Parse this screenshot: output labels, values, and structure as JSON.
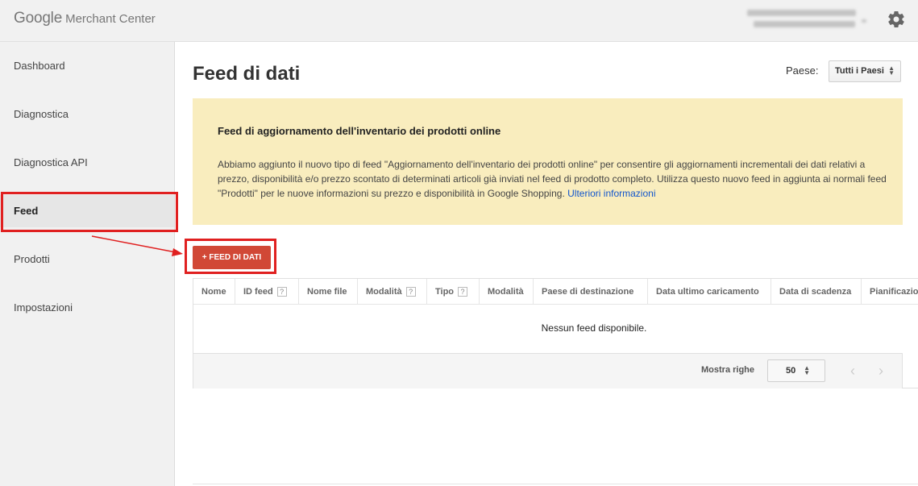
{
  "header": {
    "brand": "Google",
    "product": "Merchant Center"
  },
  "sidebar": {
    "items": [
      {
        "label": "Dashboard"
      },
      {
        "label": "Diagnostica"
      },
      {
        "label": "Diagnostica API"
      },
      {
        "label": "Feed"
      },
      {
        "label": "Prodotti"
      },
      {
        "label": "Impostazioni"
      }
    ],
    "active": "Feed"
  },
  "main": {
    "title": "Feed di dati",
    "country_label": "Paese:",
    "country_value": "Tutti i Paesi",
    "notice": {
      "title": "Feed di aggiornamento dell'inventario dei prodotti online",
      "body": "Abbiamo aggiunto il nuovo tipo di feed \"Aggiornamento dell'inventario dei prodotti online\" per consentire gli aggiornamenti incrementali dei dati relativi a prezzo, disponibilità e/o prezzo scontato di determinati articoli già inviati nel feed di prodotto completo. Utilizza questo nuovo feed in aggiunta ai normali feed \"Prodotti\" per le nuove informazioni su prezzo e disponibilità in Google Shopping.",
      "link": "Ulteriori informazioni"
    },
    "add_button": "+ FEED DI DATI",
    "table": {
      "columns": [
        "Nome",
        "ID feed",
        "Nome file",
        "Modalità",
        "Tipo",
        "Modalità",
        "Paese di destinazione",
        "Data ultimo caricamento",
        "Data di scadenza",
        "Pianificazione"
      ],
      "help_mark": "?",
      "empty": "Nessun feed disponibile.",
      "rows_label": "Mostra righe",
      "rows_value": "50",
      "prev": "‹",
      "next": "›"
    }
  },
  "colors": {
    "accent": "#d14836",
    "notice_bg": "#f9edbe",
    "highlight": "#e02020",
    "link": "#1155cc"
  }
}
